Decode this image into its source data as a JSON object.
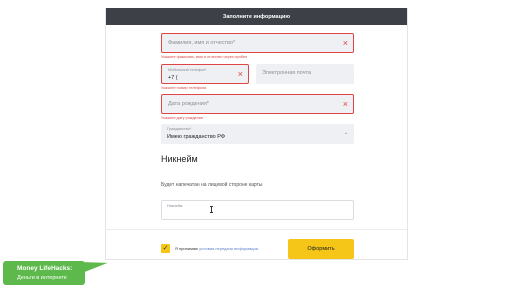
{
  "header": {
    "title": "Заполните информацию"
  },
  "form": {
    "full_name": {
      "placeholder": "Фамилия, имя и отчество*",
      "error": "Укажите фамилию, имя и отчество через пробел"
    },
    "phone": {
      "label": "Мобильный телефон*",
      "value": "+7 (",
      "error": "Укажите номер телефона"
    },
    "email": {
      "placeholder": "Электронная почта"
    },
    "birthdate": {
      "placeholder": "Дата рождения*",
      "error": "Укажите дату рождения"
    },
    "citizenship": {
      "label": "Гражданство*",
      "value": "Имею гражданство РФ"
    },
    "nickname_section": {
      "title": "Никнейм",
      "helper": "Будет напечатан на лицевой стороне карты",
      "field_label": "Никнейм"
    },
    "agreement": {
      "prefix": "Я принимаю",
      "link": "условия передачи информации"
    },
    "submit_label": "Оформить"
  },
  "badge": {
    "line1": "Money LifeHacks:",
    "line2": "Деньги в интернете"
  },
  "colors": {
    "header_bg": "#3d4147",
    "accent_yellow": "#f5c518",
    "error_red": "#e04545",
    "badge_green": "#5db94b"
  }
}
